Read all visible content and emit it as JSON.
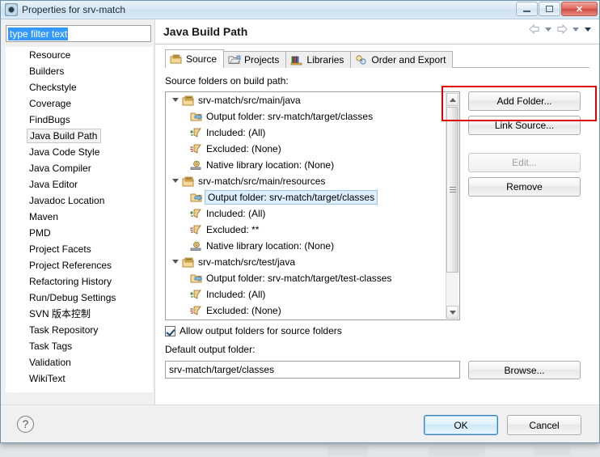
{
  "window": {
    "title": "Properties for srv-match",
    "icon": "eclipse-properties-icon",
    "minimize_label": "Minimize",
    "maximize_label": "Maximize",
    "close_label": "✕"
  },
  "filter": {
    "value": "type filter text",
    "placeholder": "type filter text"
  },
  "nav": {
    "items": [
      {
        "label": "Resource",
        "selected": false
      },
      {
        "label": "Builders",
        "selected": false
      },
      {
        "label": "Checkstyle",
        "selected": false
      },
      {
        "label": "Coverage",
        "selected": false
      },
      {
        "label": "FindBugs",
        "selected": false
      },
      {
        "label": "Java Build Path",
        "selected": true
      },
      {
        "label": "Java Code Style",
        "selected": false
      },
      {
        "label": "Java Compiler",
        "selected": false
      },
      {
        "label": "Java Editor",
        "selected": false
      },
      {
        "label": "Javadoc Location",
        "selected": false
      },
      {
        "label": "Maven",
        "selected": false
      },
      {
        "label": "PMD",
        "selected": false
      },
      {
        "label": "Project Facets",
        "selected": false
      },
      {
        "label": "Project References",
        "selected": false
      },
      {
        "label": "Refactoring History",
        "selected": false
      },
      {
        "label": "Run/Debug Settings",
        "selected": false
      },
      {
        "label": "SVN 版本控制",
        "selected": false
      },
      {
        "label": "Task Repository",
        "selected": false
      },
      {
        "label": "Task Tags",
        "selected": false
      },
      {
        "label": "Validation",
        "selected": false
      },
      {
        "label": "WikiText",
        "selected": false
      }
    ]
  },
  "page": {
    "title": "Java Build Path",
    "header_nav": {
      "back": "back-arrow",
      "back_menu": "chevron-down",
      "forward": "forward-arrow",
      "forward_menu": "chevron-down",
      "view_menu": "chevron-down"
    }
  },
  "tabs": [
    {
      "label": "Source",
      "icon": "source-folder-icon",
      "active": true
    },
    {
      "label": "Projects",
      "icon": "projects-icon",
      "active": false
    },
    {
      "label": "Libraries",
      "icon": "libraries-icon",
      "active": false
    },
    {
      "label": "Order and Export",
      "icon": "order-export-icon",
      "active": false
    }
  ],
  "source_tab": {
    "tree_label": "Source folders on build path:",
    "tree": [
      {
        "level": 1,
        "icon": "package-folder-icon",
        "label": "srv-match/src/main/java",
        "expander": true,
        "selected": false
      },
      {
        "level": 2,
        "icon": "output-folder-icon",
        "label": "Output folder: srv-match/target/classes",
        "expander": false,
        "selected": false
      },
      {
        "level": 2,
        "icon": "include-filter-icon",
        "label": "Included: (All)",
        "expander": false,
        "selected": false
      },
      {
        "level": 2,
        "icon": "exclude-filter-icon",
        "label": "Excluded: (None)",
        "expander": false,
        "selected": false
      },
      {
        "level": 2,
        "icon": "native-library-icon",
        "label": "Native library location: (None)",
        "expander": false,
        "selected": false
      },
      {
        "level": 1,
        "icon": "package-folder-icon",
        "label": "srv-match/src/main/resources",
        "expander": true,
        "selected": false
      },
      {
        "level": 2,
        "icon": "output-folder-icon",
        "label": "Output folder: srv-match/target/classes",
        "expander": false,
        "selected": true
      },
      {
        "level": 2,
        "icon": "include-filter-icon",
        "label": "Included: (All)",
        "expander": false,
        "selected": false
      },
      {
        "level": 2,
        "icon": "exclude-filter-icon",
        "label": "Excluded: **",
        "expander": false,
        "selected": false
      },
      {
        "level": 2,
        "icon": "native-library-icon",
        "label": "Native library location: (None)",
        "expander": false,
        "selected": false
      },
      {
        "level": 1,
        "icon": "package-folder-icon",
        "label": "srv-match/src/test/java",
        "expander": true,
        "selected": false
      },
      {
        "level": 2,
        "icon": "output-folder-icon",
        "label": "Output folder: srv-match/target/test-classes",
        "expander": false,
        "selected": false
      },
      {
        "level": 2,
        "icon": "include-filter-icon",
        "label": "Included: (All)",
        "expander": false,
        "selected": false
      },
      {
        "level": 2,
        "icon": "exclude-filter-icon",
        "label": "Excluded: (None)",
        "expander": false,
        "selected": false
      }
    ],
    "buttons": {
      "add_folder": "Add Folder...",
      "link_source": "Link Source...",
      "edit": "Edit...",
      "remove": "Remove"
    },
    "allow_output_checkbox": {
      "label": "Allow output folders for source folders",
      "checked": true
    },
    "default_output_label": "Default output folder:",
    "default_output_value": "srv-match/target/classes",
    "browse_label": "Browse..."
  },
  "footer": {
    "help": "?",
    "ok": "OK",
    "cancel": "Cancel"
  },
  "annotation": {
    "target": "Add Folder...",
    "color": "#e00000"
  }
}
